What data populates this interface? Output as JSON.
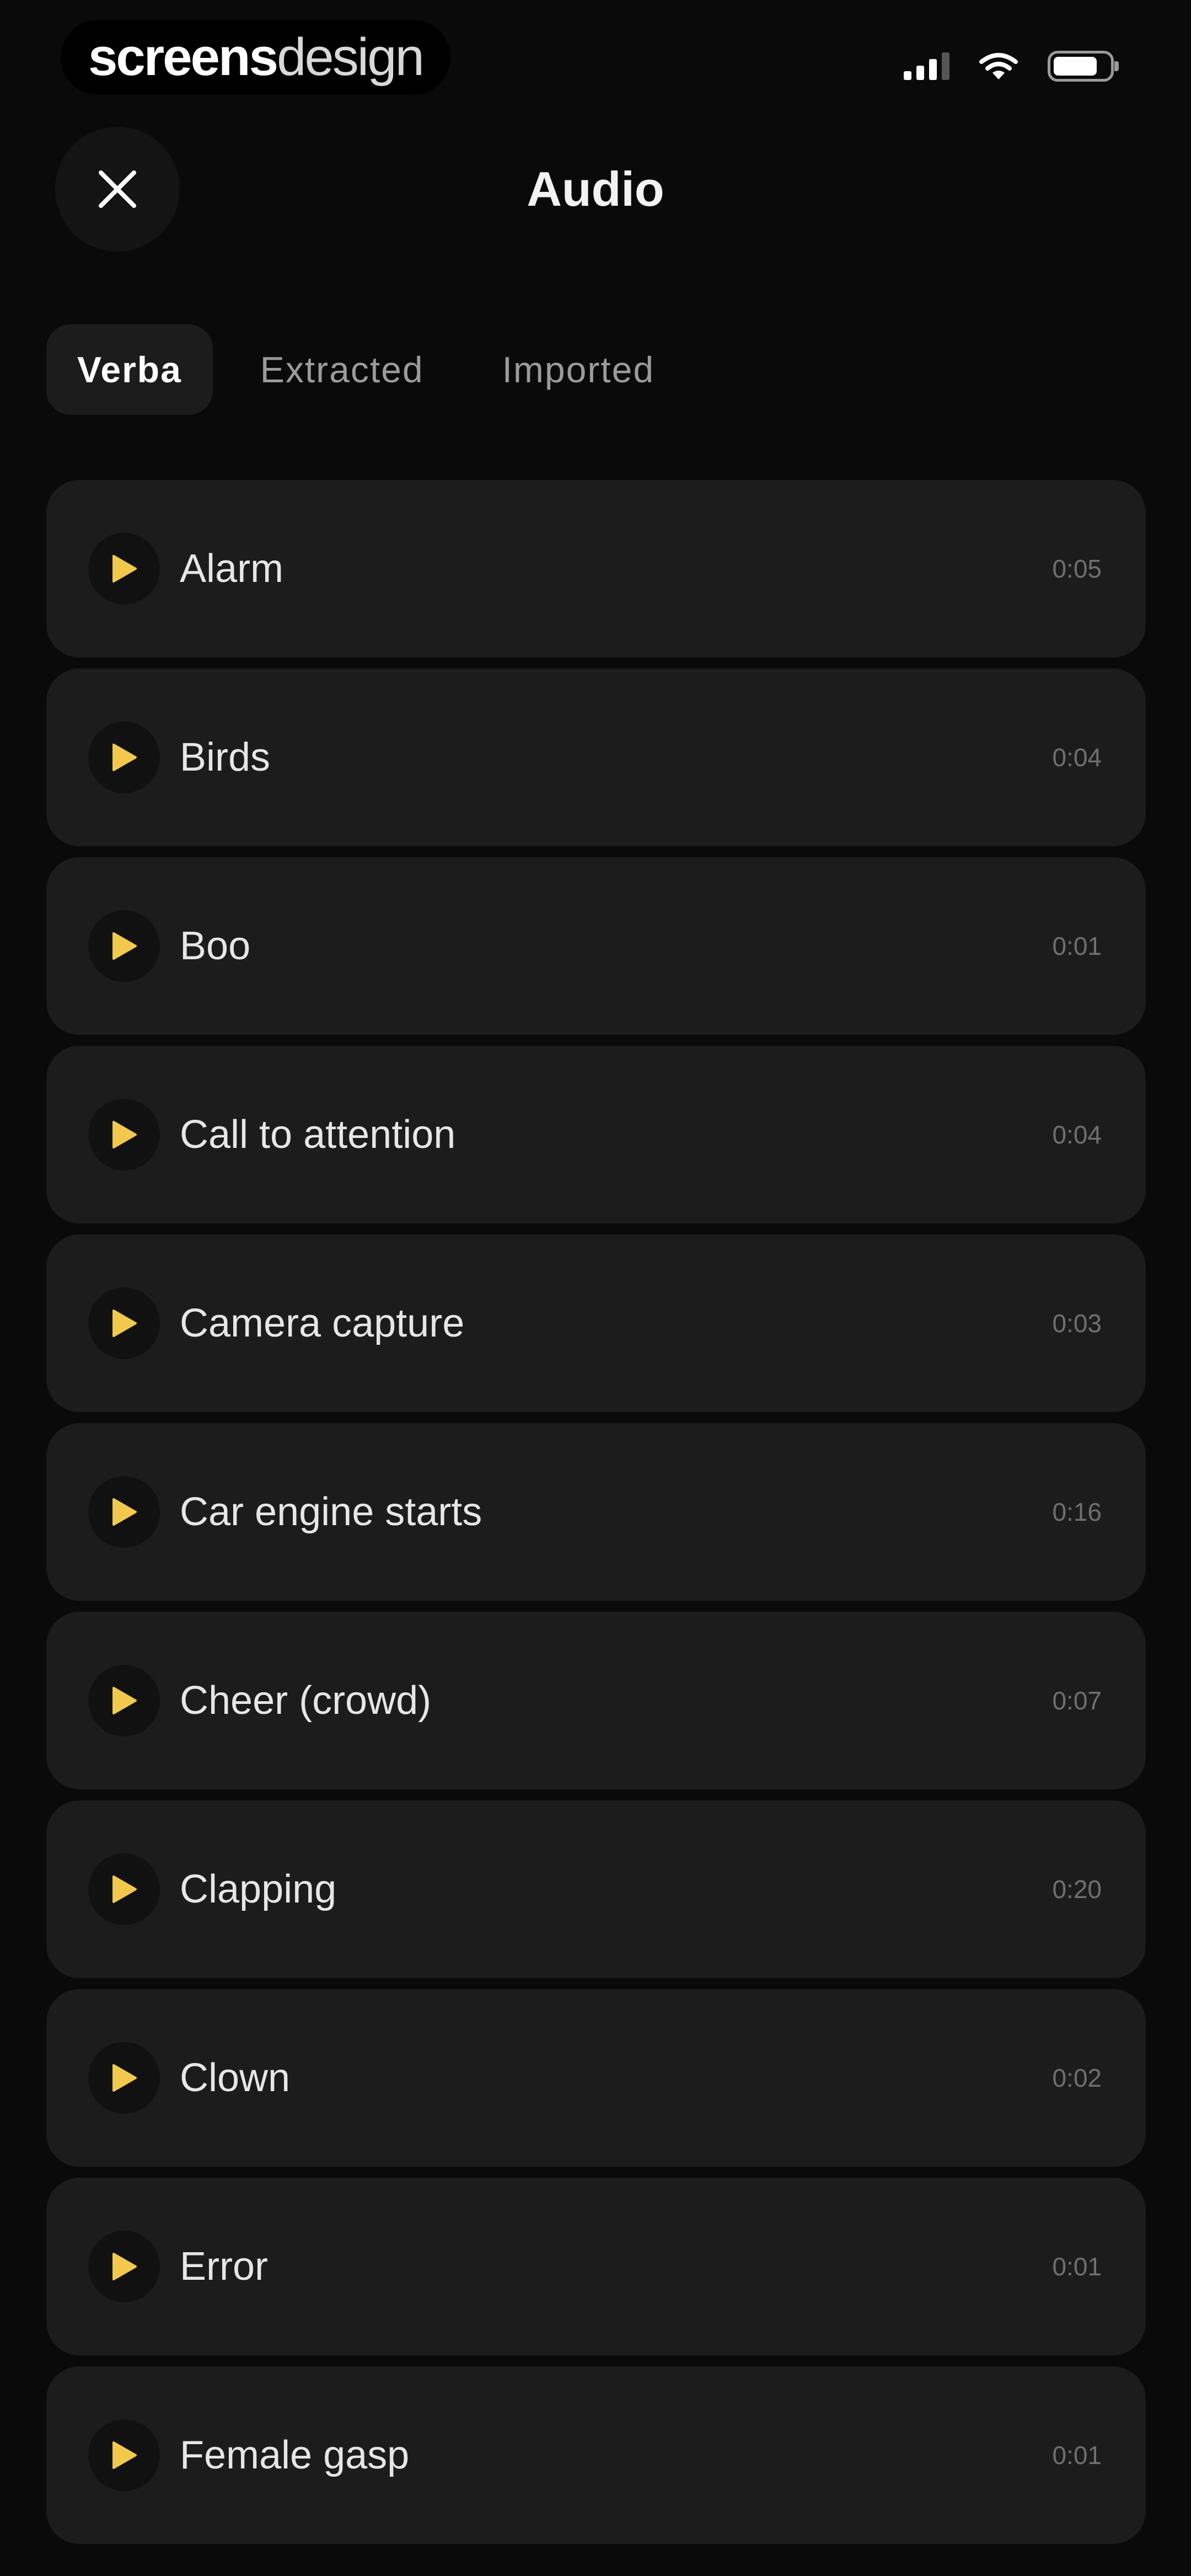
{
  "status_bar": {
    "brand_bold": "screens",
    "brand_light": "design"
  },
  "header": {
    "title": "Audio"
  },
  "tabs": [
    {
      "label": "Verba",
      "active": true
    },
    {
      "label": "Extracted",
      "active": false
    },
    {
      "label": "Imported",
      "active": false
    }
  ],
  "audio_items": [
    {
      "name": "Alarm",
      "duration": "0:05"
    },
    {
      "name": "Birds",
      "duration": "0:04"
    },
    {
      "name": "Boo",
      "duration": "0:01"
    },
    {
      "name": "Call to attention",
      "duration": "0:04"
    },
    {
      "name": "Camera capture",
      "duration": "0:03"
    },
    {
      "name": "Car engine starts",
      "duration": "0:16"
    },
    {
      "name": "Cheer (crowd)",
      "duration": "0:07"
    },
    {
      "name": "Clapping",
      "duration": "0:20"
    },
    {
      "name": "Clown",
      "duration": "0:02"
    },
    {
      "name": "Error",
      "duration": "0:01"
    },
    {
      "name": "Female gasp",
      "duration": "0:01"
    }
  ],
  "colors": {
    "background": "#0a0a0a",
    "card": "#1c1c1c",
    "accent_play": "#f2c94c",
    "text_primary": "#e6e6e6",
    "text_muted": "#6f6f6f"
  },
  "icons": {
    "close": "close-icon",
    "play": "play-icon",
    "signal": "cellular-signal-icon",
    "wifi": "wifi-icon",
    "battery": "battery-icon"
  }
}
